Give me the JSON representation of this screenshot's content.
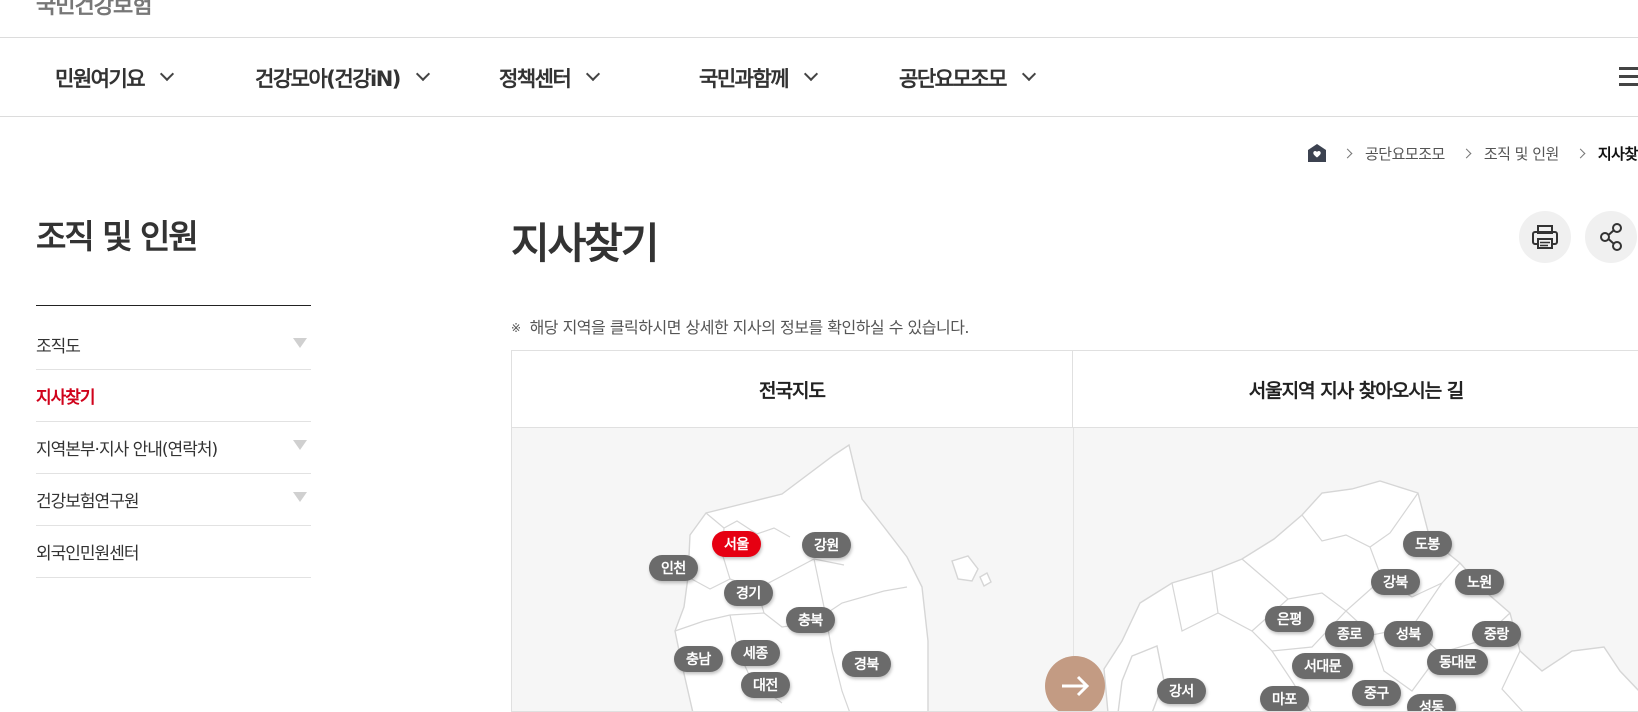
{
  "site": {
    "logo_text": "국민건강보험"
  },
  "gnb": {
    "items": [
      {
        "label": "민원여기요"
      },
      {
        "label": "건강모아(건강iN)"
      },
      {
        "label": "정책센터"
      },
      {
        "label": "국민과함께"
      },
      {
        "label": "공단요모조모"
      }
    ]
  },
  "breadcrumb": {
    "items": [
      {
        "label": "공단요모조모"
      },
      {
        "label": "조직 및 인원"
      }
    ],
    "current": "지사찾기"
  },
  "sidebar": {
    "title": "조직 및 인원",
    "items": [
      {
        "label": "조직도",
        "has_sub": true,
        "active": false
      },
      {
        "label": "지사찾기",
        "has_sub": false,
        "active": true
      },
      {
        "label": "지역본부·지사 안내(연락처)",
        "has_sub": true,
        "active": false
      },
      {
        "label": "건강보험연구원",
        "has_sub": true,
        "active": false
      },
      {
        "label": "외국인민원센터",
        "has_sub": false,
        "active": false
      }
    ]
  },
  "main": {
    "title": "지사찾기",
    "notice_mark": "※",
    "notice": "해당 지역을 클릭하시면 상세한 지사의 정보를 확인하실 수 있습니다.",
    "tabs": [
      {
        "label": "전국지도"
      },
      {
        "label": "서울지역 지사 찾아오시는 길"
      }
    ]
  },
  "national_map": {
    "regions": [
      {
        "label": "서울",
        "active": true
      },
      {
        "label": "강원",
        "active": false
      },
      {
        "label": "인천",
        "active": false
      },
      {
        "label": "경기",
        "active": false
      },
      {
        "label": "충북",
        "active": false
      },
      {
        "label": "충남",
        "active": false
      },
      {
        "label": "세종",
        "active": false
      },
      {
        "label": "경북",
        "active": false
      },
      {
        "label": "대전",
        "active": false
      }
    ]
  },
  "seoul_map": {
    "districts": [
      {
        "label": "도봉"
      },
      {
        "label": "강북"
      },
      {
        "label": "노원"
      },
      {
        "label": "은평"
      },
      {
        "label": "종로"
      },
      {
        "label": "성북"
      },
      {
        "label": "중랑"
      },
      {
        "label": "서대문"
      },
      {
        "label": "동대문"
      },
      {
        "label": "강서"
      },
      {
        "label": "마포"
      },
      {
        "label": "중구"
      },
      {
        "label": "성동"
      }
    ]
  },
  "colors": {
    "accent_red": "#e60012",
    "active_menu": "#d0021b",
    "pill_gray": "#6b6b6b",
    "arrow_button": "#c39b83"
  },
  "icons": {
    "home": "home-icon",
    "print": "print-icon",
    "share": "share-icon",
    "all_menu": "hamburger-icon",
    "arrow": "arrow-right-icon"
  }
}
